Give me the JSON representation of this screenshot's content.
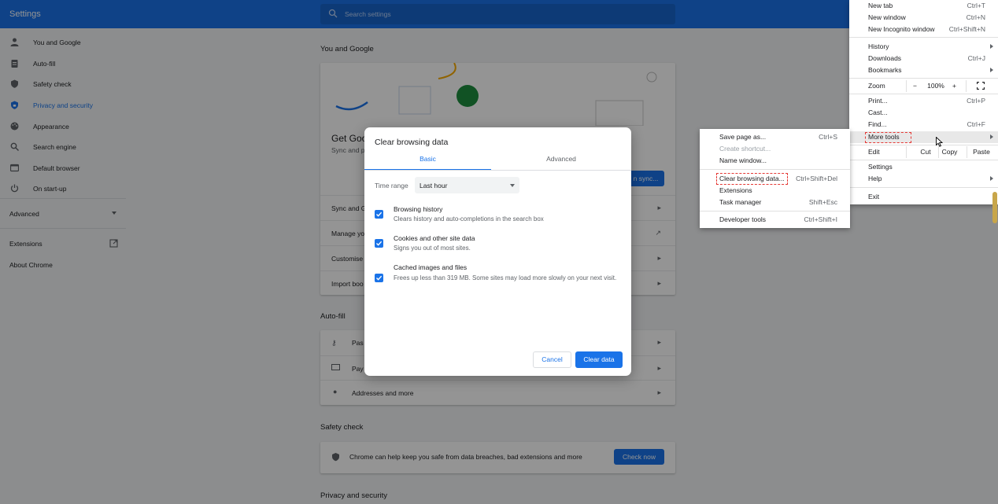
{
  "settings": {
    "title": "Settings",
    "search_placeholder": "Search settings",
    "nav": [
      {
        "label": "You and Google",
        "icon": "person-icon"
      },
      {
        "label": "Auto-fill",
        "icon": "clipboard-icon"
      },
      {
        "label": "Safety check",
        "icon": "shield-icon"
      },
      {
        "label": "Privacy and security",
        "icon": "shield-lock-icon"
      },
      {
        "label": "Appearance",
        "icon": "palette-icon"
      },
      {
        "label": "Search engine",
        "icon": "search-icon"
      },
      {
        "label": "Default browser",
        "icon": "browser-icon"
      },
      {
        "label": "On start-up",
        "icon": "power-icon"
      }
    ],
    "advanced": "Advanced",
    "extensions": "Extensions",
    "about": "About Chrome",
    "sections": {
      "you_and_google": "You and Google",
      "autofill": "Auto-fill",
      "safety_check": "Safety check",
      "privacy": "Privacy and security"
    },
    "you_google_card": {
      "heading": "Get Goo",
      "sub": "Sync and p",
      "sync_button": "n sync...",
      "rows": [
        "Sync and G",
        "Manage yo",
        "Customise",
        "Import boo"
      ]
    },
    "autofill_rows": [
      "Pas",
      "Pay",
      "Addresses and more"
    ],
    "safety_text": "Chrome can help keep you safe from data breaches, bad extensions and more",
    "check_now": "Check now"
  },
  "dialog": {
    "title": "Clear browsing data",
    "tabs": [
      "Basic",
      "Advanced"
    ],
    "time_range_label": "Time range",
    "time_range_value": "Last hour",
    "options": [
      {
        "title": "Browsing history",
        "desc": "Clears history and auto-completions in the search box",
        "checked": true
      },
      {
        "title": "Cookies and other site data",
        "desc": "Signs you out of most sites.",
        "checked": true
      },
      {
        "title": "Cached images and files",
        "desc": "Frees up less than 319 MB. Some sites may load more slowly on your next visit.",
        "checked": true
      }
    ],
    "cancel": "Cancel",
    "clear": "Clear data"
  },
  "chrome_menu": {
    "items": {
      "new_tab": {
        "label": "New tab",
        "shortcut": "Ctrl+T"
      },
      "new_window": {
        "label": "New window",
        "shortcut": "Ctrl+N"
      },
      "new_incognito": {
        "label": "New Incognito window",
        "shortcut": "Ctrl+Shift+N"
      },
      "history": {
        "label": "History"
      },
      "downloads": {
        "label": "Downloads",
        "shortcut": "Ctrl+J"
      },
      "bookmarks": {
        "label": "Bookmarks"
      },
      "zoom": {
        "label": "Zoom",
        "minus": "−",
        "value": "100%",
        "plus": "+"
      },
      "print": {
        "label": "Print...",
        "shortcut": "Ctrl+P"
      },
      "cast": {
        "label": "Cast..."
      },
      "find": {
        "label": "Find...",
        "shortcut": "Ctrl+F"
      },
      "more_tools": {
        "label": "More tools"
      },
      "edit": {
        "label": "Edit",
        "cut": "Cut",
        "copy": "Copy",
        "paste": "Paste"
      },
      "settings": {
        "label": "Settings"
      },
      "help": {
        "label": "Help"
      },
      "exit": {
        "label": "Exit"
      }
    }
  },
  "more_tools_menu": {
    "save_page": {
      "label": "Save page as...",
      "shortcut": "Ctrl+S"
    },
    "create_shortcut": {
      "label": "Create shortcut..."
    },
    "name_window": {
      "label": "Name window..."
    },
    "clear_browsing": {
      "label": "Clear browsing data...",
      "shortcut": "Ctrl+Shift+Del"
    },
    "extensions": {
      "label": "Extensions"
    },
    "task_manager": {
      "label": "Task manager",
      "shortcut": "Shift+Esc"
    },
    "developer_tools": {
      "label": "Developer tools",
      "shortcut": "Ctrl+Shift+I"
    }
  },
  "colors": {
    "accent": "#1a73e8",
    "highlight_dash": "#e53935"
  }
}
